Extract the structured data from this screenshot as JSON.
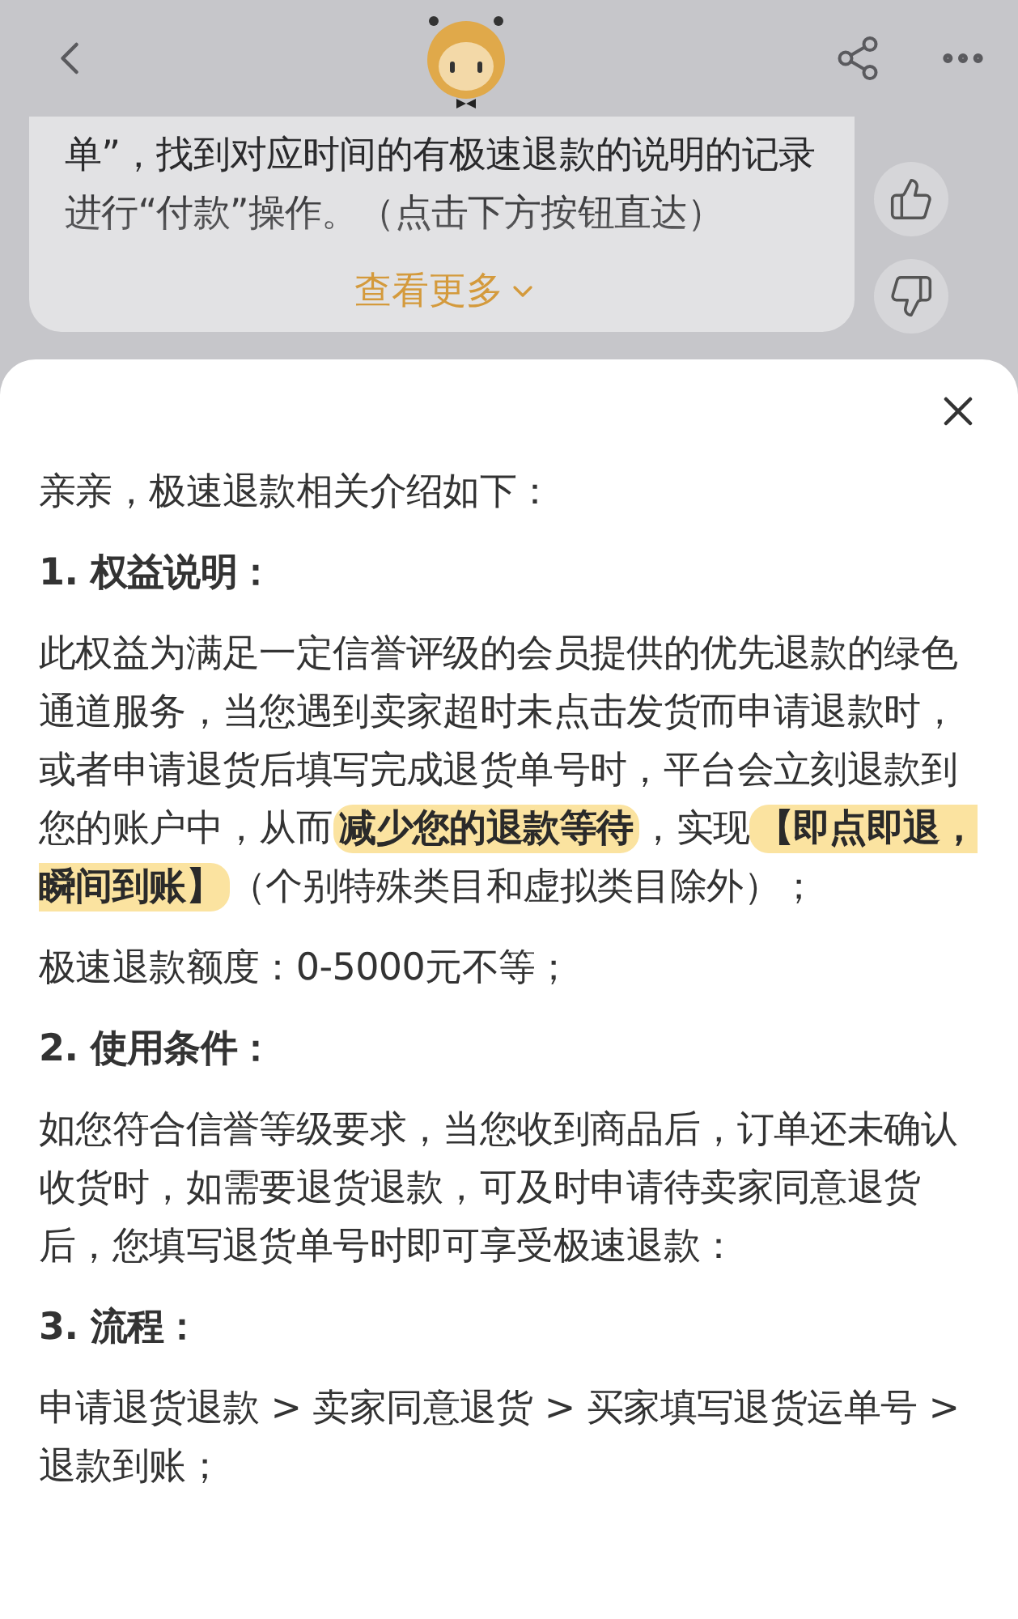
{
  "bubble": {
    "text": "单”，找到对应时间的有极速退款的说明的记录进行“付款”操作。（点击下方按钮直达）",
    "more_link": "查看更多"
  },
  "sheet": {
    "blocks": [
      {
        "kind": "paragraph",
        "segments": [
          {
            "text": "亲亲，极速退款相关介绍如下：",
            "highlighted": false
          }
        ]
      },
      {
        "kind": "heading",
        "segments": [
          {
            "text": "1. 权益说明：",
            "highlighted": false
          }
        ]
      },
      {
        "kind": "paragraph",
        "segments": [
          {
            "text": "此权益为满足一定信誉评级的会员提供的优先退款的绿色通道服务，当您遇到卖家超时未点击发货而申请退款时，或者申请退货后填写完成退货单号时，平台会立刻退款到您的账户中，从而",
            "highlighted": false
          },
          {
            "text": "减少您的退款等待",
            "highlighted": true
          },
          {
            "text": "，实现",
            "highlighted": false
          },
          {
            "text": "【即点即退，瞬间到账】",
            "highlighted": true
          },
          {
            "text": "（个别特殊类目和虚拟类目除外）；",
            "highlighted": false
          }
        ]
      },
      {
        "kind": "paragraph",
        "segments": [
          {
            "text": "极速退款额度：0-5000元不等；",
            "highlighted": false
          }
        ]
      },
      {
        "kind": "heading",
        "segments": [
          {
            "text": "2. 使用条件：",
            "highlighted": false
          }
        ]
      },
      {
        "kind": "paragraph",
        "segments": [
          {
            "text": "如您符合信誉等级要求，当您收到商品后，订单还未确认收货时，如需要退货退款，可及时申请待卖家同意退货后，您填写退货单号时即可享受极速退款：",
            "highlighted": false
          }
        ]
      },
      {
        "kind": "heading",
        "segments": [
          {
            "text": "3. 流程：",
            "highlighted": false
          }
        ]
      },
      {
        "kind": "paragraph",
        "segments": [
          {
            "text": "申请退货退款 > 卖家同意退货 > 买家填写退货运单号 > 退款到账；",
            "highlighted": false
          }
        ]
      }
    ]
  }
}
